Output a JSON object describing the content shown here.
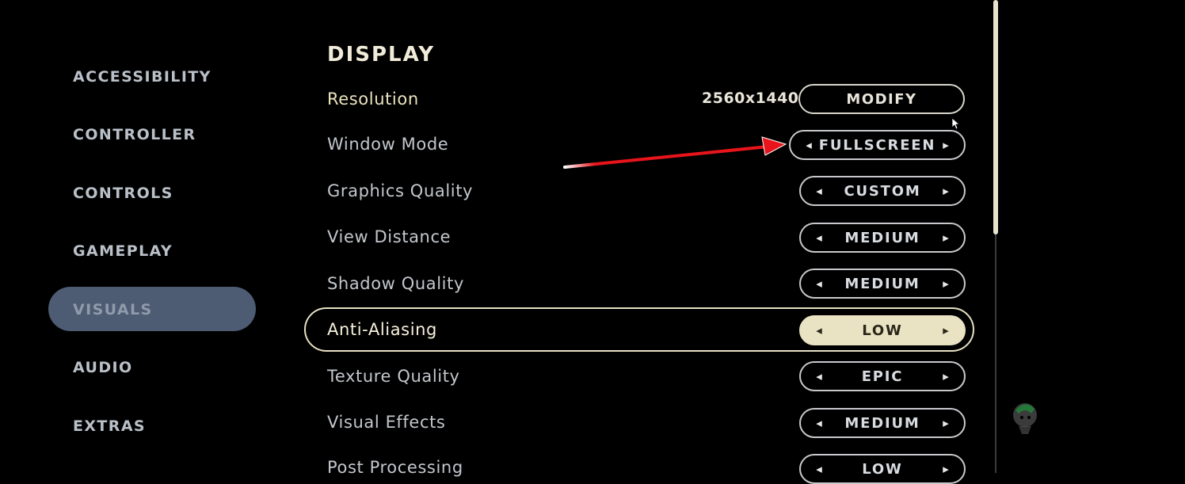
{
  "sidebar": {
    "items": [
      {
        "label": "ACCESSIBILITY"
      },
      {
        "label": "CONTROLLER"
      },
      {
        "label": "CONTROLS"
      },
      {
        "label": "GAMEPLAY"
      },
      {
        "label": "VISUALS"
      },
      {
        "label": "AUDIO"
      },
      {
        "label": "EXTRAS"
      }
    ],
    "active": "VISUALS"
  },
  "section": {
    "title": "DISPLAY"
  },
  "settings": {
    "resolution": {
      "label": "Resolution",
      "value": "2560x1440",
      "button": "MODIFY"
    },
    "rows": [
      {
        "label": "Window Mode",
        "value": "FULLSCREEN"
      },
      {
        "label": "Graphics Quality",
        "value": "CUSTOM"
      },
      {
        "label": "View Distance",
        "value": "MEDIUM"
      },
      {
        "label": "Shadow Quality",
        "value": "MEDIUM"
      },
      {
        "label": "Anti-Aliasing",
        "value": "LOW"
      },
      {
        "label": "Texture Quality",
        "value": "EPIC"
      },
      {
        "label": "Visual Effects",
        "value": "MEDIUM"
      },
      {
        "label": "Post Processing",
        "value": "LOW"
      }
    ],
    "selected": "Anti-Aliasing"
  },
  "icons": {
    "arrow_left": "◂",
    "arrow_right": "▸",
    "annotation": "red-arrow-icon",
    "cursor": "mouse-cursor-icon",
    "watermark": "watermark-logo-icon"
  },
  "colors": {
    "accent": "#e9e3c4",
    "active_nav": "#4e5c73",
    "annotation": "#e8141b"
  }
}
